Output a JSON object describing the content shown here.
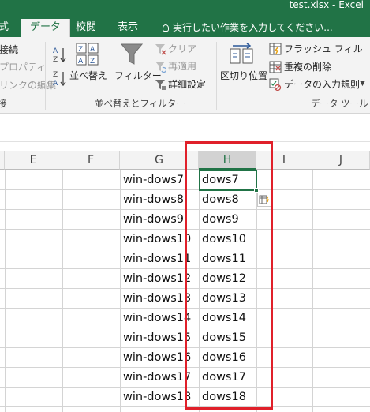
{
  "title": "test.xlsx - Excel",
  "tabs": [
    {
      "label": "式"
    },
    {
      "label": "データ"
    },
    {
      "label": "校閲"
    },
    {
      "label": "表示"
    }
  ],
  "tell_me": "実行したい作業を入力してください...",
  "ribbon": {
    "connections": {
      "items": [
        "接続",
        "プロパティ",
        "リンクの編集"
      ],
      "group_label": "接"
    },
    "sort_filter": {
      "sort_button": "並べ替え",
      "filter_button": "フィルター",
      "clear": "クリア",
      "reapply": "再適用",
      "advanced": "詳細設定",
      "group_label": "並べ替えとフィルター"
    },
    "data_tools": {
      "text_to_columns": "区切り位置",
      "flash_fill": "フラッシュ フィル",
      "remove_duplicates": "重複の削除",
      "data_validation": "データの入力規則",
      "group_label": "データ ツール"
    }
  },
  "columns": [
    "E",
    "F",
    "G",
    "H",
    "I",
    "J"
  ],
  "selected_column": "H",
  "rows": [
    {
      "g": "win-dows7",
      "h": "dows7"
    },
    {
      "g": "win-dows8",
      "h": "dows8"
    },
    {
      "g": "win-dows9",
      "h": "dows9"
    },
    {
      "g": "win-dows10",
      "h": "dows10"
    },
    {
      "g": "win-dows11",
      "h": "dows11"
    },
    {
      "g": "win-dows12",
      "h": "dows12"
    },
    {
      "g": "win-dows13",
      "h": "dows13"
    },
    {
      "g": "win-dows14",
      "h": "dows14"
    },
    {
      "g": "win-dows15",
      "h": "dows15"
    },
    {
      "g": "win-dows16",
      "h": "dows16"
    },
    {
      "g": "win-dows17",
      "h": "dows17"
    },
    {
      "g": "win-dows18",
      "h": "dows18"
    }
  ],
  "colors": {
    "excel_green": "#217346",
    "highlight_red": "#e0202a",
    "ribbon_bg": "#f3f3f3"
  },
  "icons": [
    "lightbulb-icon",
    "sort-az-icon",
    "sort-za-icon",
    "sort-icon",
    "filter-icon",
    "clear-filter-icon",
    "reapply-icon",
    "advanced-filter-icon",
    "text-to-columns-icon",
    "flash-fill-icon",
    "remove-duplicates-icon",
    "data-validation-icon",
    "flash-fill-options-icon"
  ]
}
